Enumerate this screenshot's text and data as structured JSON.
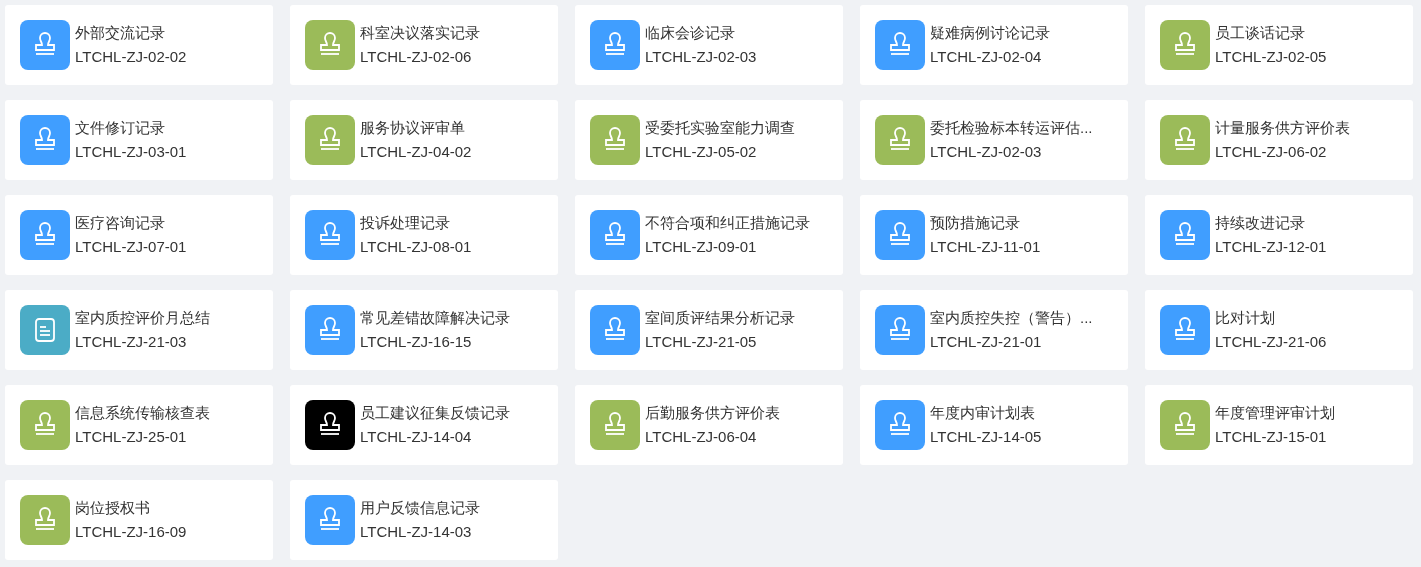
{
  "cards": [
    {
      "title": "外部交流记录",
      "code": "LTCHL-ZJ-02-02",
      "color": "#409eff",
      "kind": "stamp"
    },
    {
      "title": "科室决议落实记录",
      "code": "LTCHL-ZJ-02-06",
      "color": "#9bbb59",
      "kind": "stamp"
    },
    {
      "title": "临床会诊记录",
      "code": "LTCHL-ZJ-02-03",
      "color": "#409eff",
      "kind": "stamp"
    },
    {
      "title": "疑难病例讨论记录",
      "code": "LTCHL-ZJ-02-04",
      "color": "#409eff",
      "kind": "stamp"
    },
    {
      "title": "员工谈话记录",
      "code": "LTCHL-ZJ-02-05",
      "color": "#9bbb59",
      "kind": "stamp"
    },
    {
      "title": "文件修订记录",
      "code": "LTCHL-ZJ-03-01",
      "color": "#409eff",
      "kind": "stamp"
    },
    {
      "title": "服务协议评审单",
      "code": "LTCHL-ZJ-04-02",
      "color": "#9bbb59",
      "kind": "stamp"
    },
    {
      "title": "受委托实验室能力调查",
      "code": "LTCHL-ZJ-05-02",
      "color": "#9bbb59",
      "kind": "stamp"
    },
    {
      "title": "委托检验标本转运评估...",
      "code": "LTCHL-ZJ-02-03",
      "color": "#9bbb59",
      "kind": "stamp"
    },
    {
      "title": "计量服务供方评价表",
      "code": "LTCHL-ZJ-06-02",
      "color": "#9bbb59",
      "kind": "stamp"
    },
    {
      "title": "医疗咨询记录",
      "code": "LTCHL-ZJ-07-01",
      "color": "#409eff",
      "kind": "stamp"
    },
    {
      "title": "投诉处理记录",
      "code": "LTCHL-ZJ-08-01",
      "color": "#409eff",
      "kind": "stamp"
    },
    {
      "title": "不符合项和纠正措施记录",
      "code": "LTCHL-ZJ-09-01",
      "color": "#409eff",
      "kind": "stamp"
    },
    {
      "title": "预防措施记录",
      "code": "LTCHL-ZJ-11-01",
      "color": "#409eff",
      "kind": "stamp"
    },
    {
      "title": "持续改进记录",
      "code": "LTCHL-ZJ-12-01",
      "color": "#409eff",
      "kind": "stamp"
    },
    {
      "title": "室内质控评价月总结",
      "code": "LTCHL-ZJ-21-03",
      "color": "#4bacc6",
      "kind": "document"
    },
    {
      "title": "常见差错故障解决记录",
      "code": "LTCHL-ZJ-16-15",
      "color": "#409eff",
      "kind": "stamp"
    },
    {
      "title": "室间质评结果分析记录",
      "code": "LTCHL-ZJ-21-05",
      "color": "#409eff",
      "kind": "stamp"
    },
    {
      "title": "室内质控失控（警告）...",
      "code": "LTCHL-ZJ-21-01",
      "color": "#409eff",
      "kind": "stamp"
    },
    {
      "title": "比对计划",
      "code": "LTCHL-ZJ-21-06",
      "color": "#409eff",
      "kind": "stamp"
    },
    {
      "title": "信息系统传输核查表",
      "code": "LTCHL-ZJ-25-01",
      "color": "#9bbb59",
      "kind": "stamp"
    },
    {
      "title": "员工建议征集反馈记录",
      "code": "LTCHL-ZJ-14-04",
      "color": "#000000",
      "kind": "stamp"
    },
    {
      "title": "后勤服务供方评价表",
      "code": "LTCHL-ZJ-06-04",
      "color": "#9bbb59",
      "kind": "stamp"
    },
    {
      "title": "年度内审计划表",
      "code": "LTCHL-ZJ-14-05",
      "color": "#409eff",
      "kind": "stamp"
    },
    {
      "title": "年度管理评审计划",
      "code": "LTCHL-ZJ-15-01",
      "color": "#9bbb59",
      "kind": "stamp"
    },
    {
      "title": "岗位授权书",
      "code": "LTCHL-ZJ-16-09",
      "color": "#9bbb59",
      "kind": "stamp"
    },
    {
      "title": "用户反馈信息记录",
      "code": "LTCHL-ZJ-14-03",
      "color": "#409eff",
      "kind": "stamp"
    }
  ]
}
